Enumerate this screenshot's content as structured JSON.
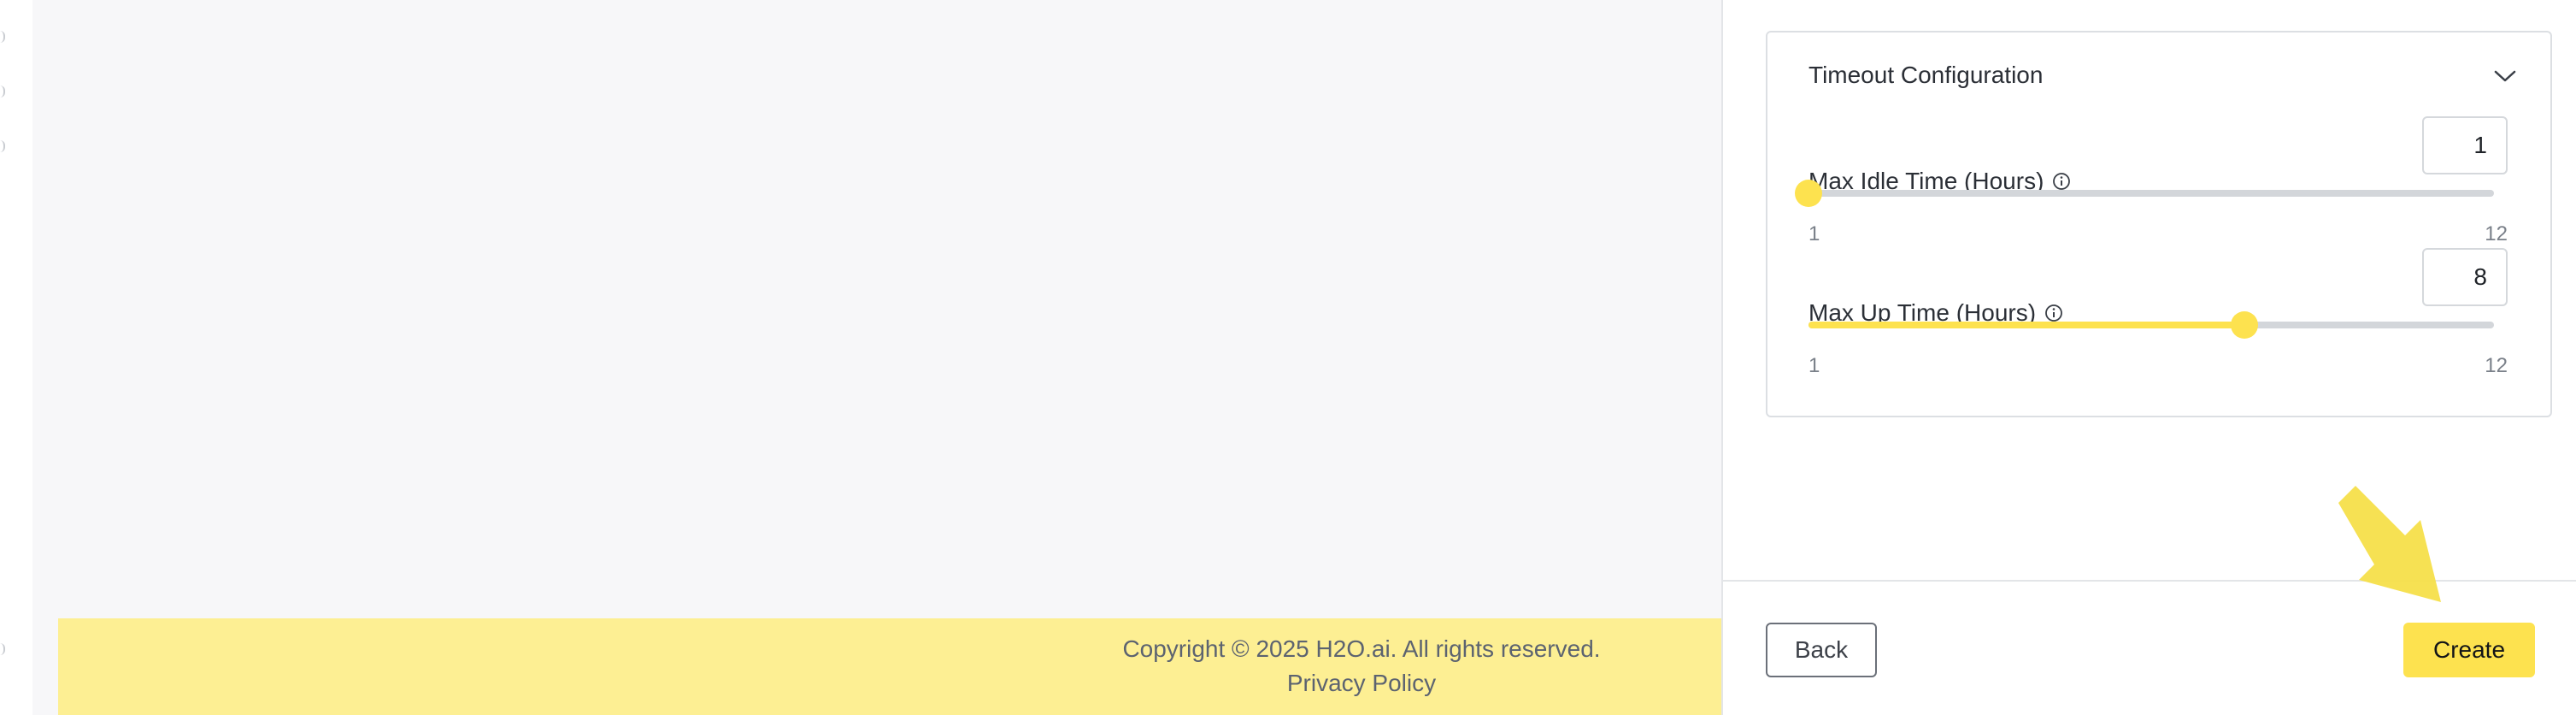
{
  "footer": {
    "copyright": "Copyright © 2025 H2O.ai. All rights reserved.",
    "privacy_link": "Privacy Policy"
  },
  "timeout_config": {
    "title": "Timeout Configuration",
    "max_idle": {
      "label": "Max Idle Time (Hours)",
      "value": "1",
      "min": "1",
      "max": "12",
      "fraction": 0.0
    },
    "max_up": {
      "label": "Max Up Time (Hours)",
      "value": "8",
      "min": "1",
      "max": "12",
      "fraction": 0.6364
    }
  },
  "actions": {
    "back_label": "Back",
    "create_label": "Create"
  },
  "colors": {
    "accent": "#fde24f",
    "footer_bg": "#fdef93",
    "panel_bg": "#ffffff",
    "main_bg": "#f7f7f9"
  },
  "icons": {
    "info": "info-icon",
    "chevron": "chevron-down-icon",
    "pointer": "pointer-arrow-icon"
  }
}
